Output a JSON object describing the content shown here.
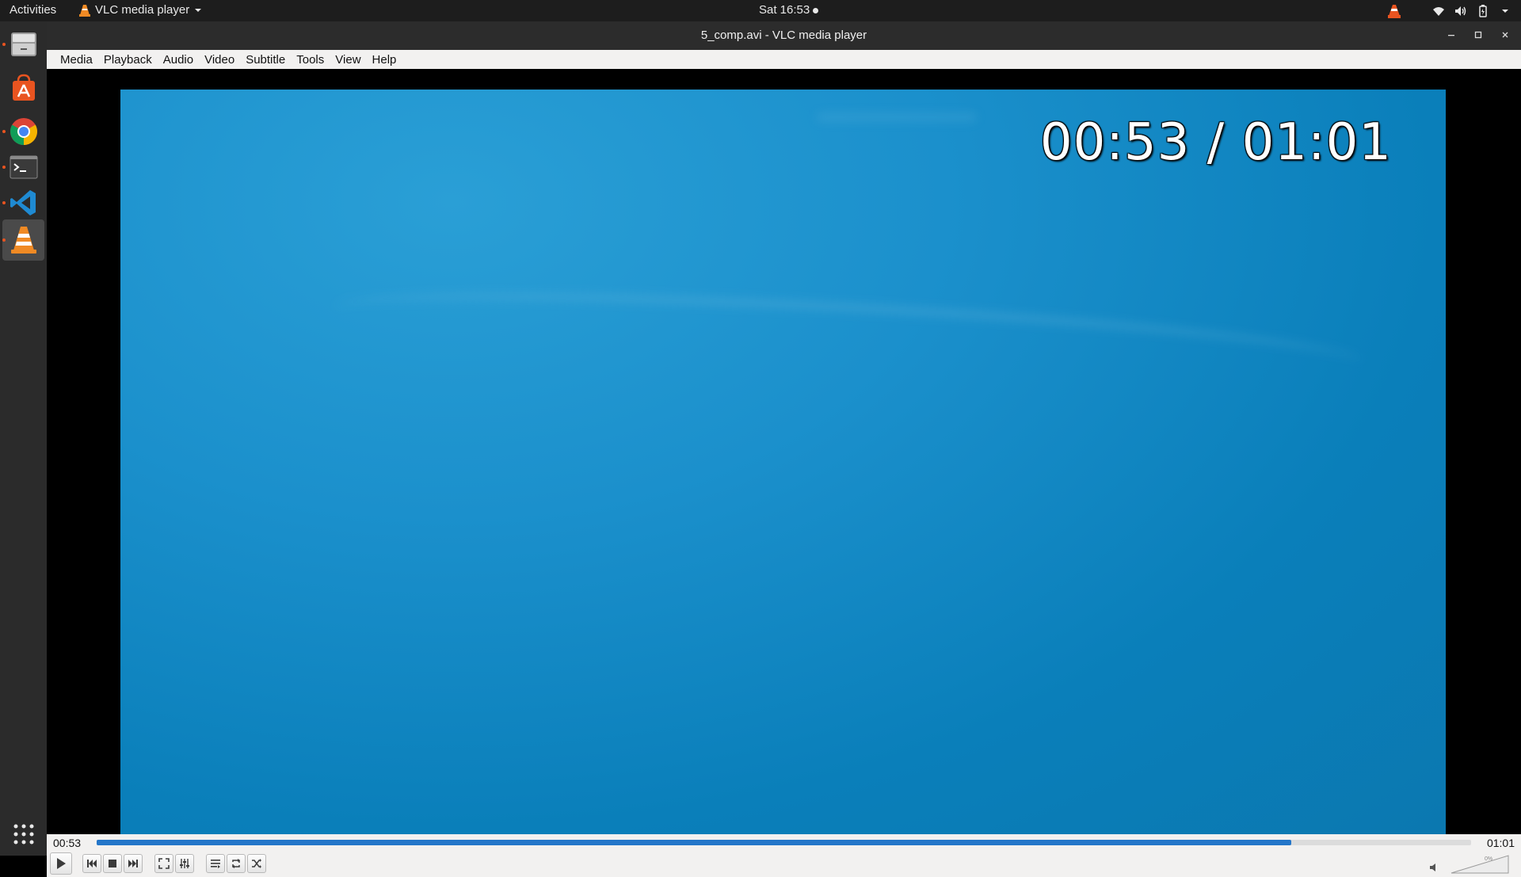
{
  "topbar": {
    "activities": "Activities",
    "app_menu_label": "VLC media player",
    "clock": "Sat 16:53"
  },
  "dock": {
    "items": [
      {
        "name": "files",
        "icon": "file-cabinet-icon",
        "running": true
      },
      {
        "name": "ubuntu-software",
        "icon": "software-bag-icon",
        "running": false
      },
      {
        "name": "chrome",
        "icon": "chrome-icon",
        "running": true
      },
      {
        "name": "terminal",
        "icon": "terminal-icon",
        "running": true
      },
      {
        "name": "vscode",
        "icon": "vscode-icon",
        "running": true
      },
      {
        "name": "vlc",
        "icon": "vlc-cone-icon",
        "running": true,
        "active": true
      }
    ],
    "apps_grid_icon": "show-apps-icon"
  },
  "window": {
    "title": "5_comp.avi - VLC media player",
    "menu": [
      "Media",
      "Playback",
      "Audio",
      "Video",
      "Subtitle",
      "Tools",
      "View",
      "Help"
    ]
  },
  "video": {
    "osd_time": "00:53 / 01:01"
  },
  "controls": {
    "elapsed": "00:53",
    "total": "01:01",
    "progress_fraction": 0.869,
    "volume_label": "0%",
    "volume_fraction": 0.0
  },
  "colors": {
    "accent": "#2476c9",
    "ubuntu_orange": "#e95420",
    "vlc_orange": "#f08a24"
  }
}
